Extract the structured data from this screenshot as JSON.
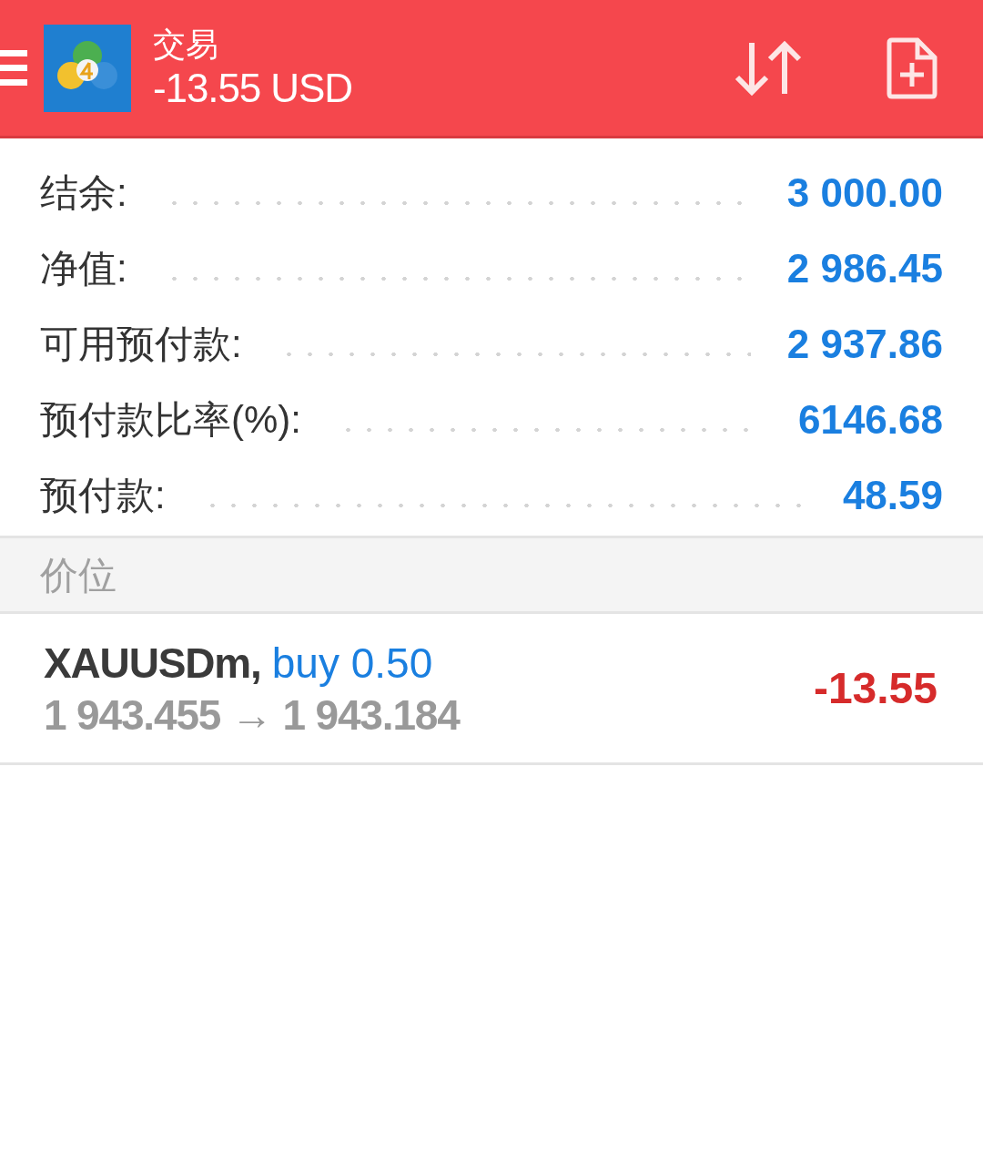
{
  "header": {
    "title": "交易",
    "profit": "-13.55 USD"
  },
  "summary": [
    {
      "label": "结余:",
      "value": "3 000.00"
    },
    {
      "label": "净值:",
      "value": "2 986.45"
    },
    {
      "label": "可用预付款:",
      "value": "2 937.86"
    },
    {
      "label": "预付款比率(%):",
      "value": "6146.68"
    },
    {
      "label": "预付款:",
      "value": "48.59"
    }
  ],
  "section": {
    "title": "价位"
  },
  "positions": [
    {
      "symbol": "XAUUSDm,",
      "order": "buy 0.50",
      "prices": "1 943.455 → 1 943.184",
      "profit": "-13.55"
    }
  ]
}
